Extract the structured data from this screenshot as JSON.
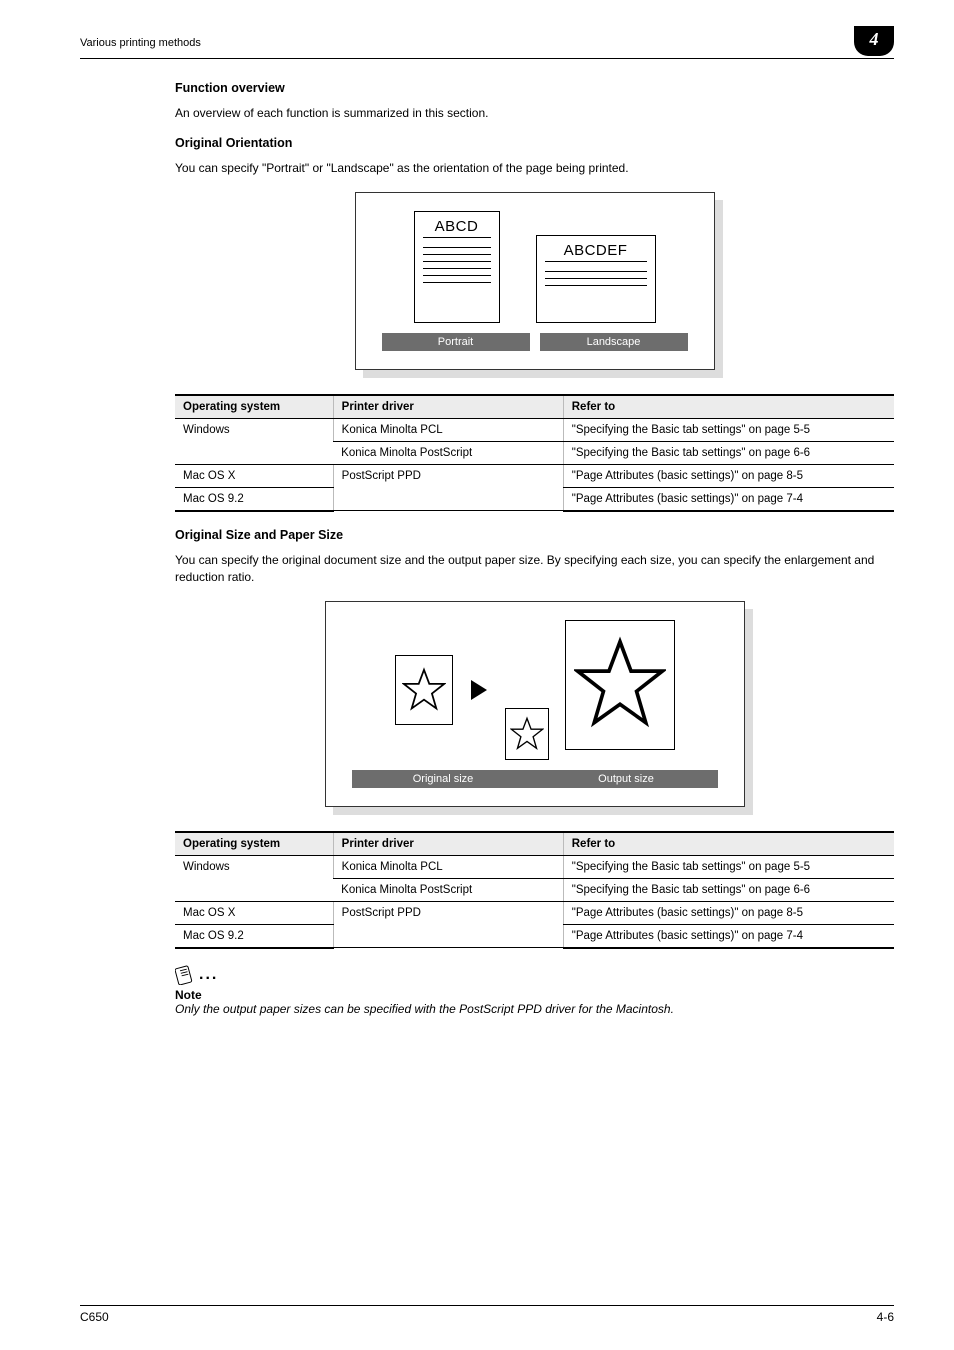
{
  "header": {
    "left": "Various printing methods",
    "chapter": "4"
  },
  "s1": {
    "title": "Function overview",
    "body": "An overview of each function is summarized in this section."
  },
  "s2": {
    "title": "Original Orientation",
    "body": "You can specify \"Portrait\" or \"Landscape\" as the orientation of the page being printed.",
    "illus": {
      "p_label": "ABCD",
      "l_label": "ABCDEF",
      "cap_p": "Portrait",
      "cap_l": "Landscape"
    }
  },
  "table_headers": {
    "os": "Operating system",
    "drv": "Printer driver",
    "ref": "Refer to"
  },
  "table1": {
    "r1": {
      "os": "Windows",
      "drv": "Konica Minolta PCL",
      "ref": "\"Specifying the Basic tab settings\" on page 5-5"
    },
    "r2": {
      "os": "",
      "drv": "Konica Minolta PostScript",
      "ref": "\"Specifying the Basic tab settings\" on page 6-6"
    },
    "r3": {
      "os": "Mac OS X",
      "drv": "PostScript PPD",
      "ref": "\"Page Attributes (basic settings)\" on page 8-5"
    },
    "r4": {
      "os": "Mac OS 9.2",
      "drv": "",
      "ref": "\"Page Attributes (basic settings)\" on page 7-4"
    }
  },
  "s3": {
    "title": "Original Size and Paper Size",
    "body": "You can specify the original document size and the output paper size. By specifying each size, you can specify the enlargement and reduction ratio.",
    "illus": {
      "cap_orig": "Original size",
      "cap_out": "Output size"
    }
  },
  "table2": {
    "r1": {
      "os": "Windows",
      "drv": "Konica Minolta PCL",
      "ref": "\"Specifying the Basic tab settings\" on page 5-5"
    },
    "r2": {
      "os": "",
      "drv": "Konica Minolta PostScript",
      "ref": "\"Specifying the Basic tab settings\" on page 6-6"
    },
    "r3": {
      "os": "Mac OS X",
      "drv": "PostScript PPD",
      "ref": "\"Page Attributes (basic settings)\" on page 8-5"
    },
    "r4": {
      "os": "Mac OS 9.2",
      "drv": "",
      "ref": "\"Page Attributes (basic settings)\" on page 7-4"
    }
  },
  "note": {
    "label": "Note",
    "text": "Only the output paper sizes can be specified with the PostScript PPD driver for the Macintosh."
  },
  "footer": {
    "left": "C650",
    "right": "4-6"
  }
}
